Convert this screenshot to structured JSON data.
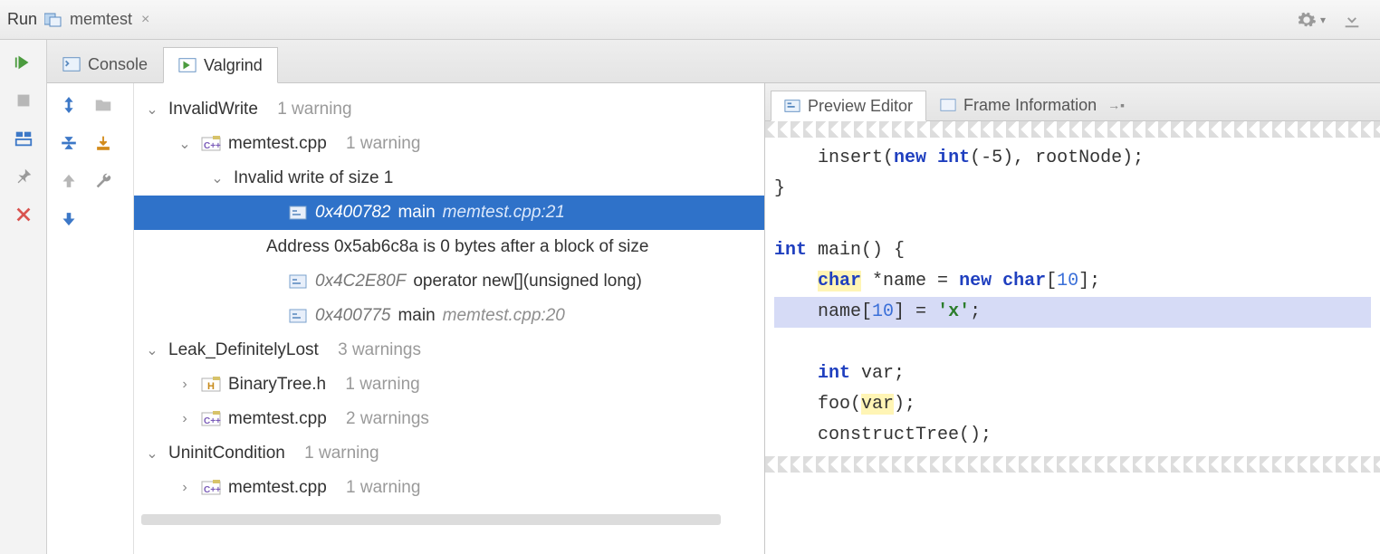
{
  "topbar": {
    "run": "Run",
    "config_name": "memtest"
  },
  "tabs": {
    "console": "Console",
    "valgrind": "Valgrind"
  },
  "tree": [
    {
      "level": 0,
      "twisty": "v",
      "kind": "group",
      "label": "InvalidWrite",
      "meta": "1 warning"
    },
    {
      "level": 1,
      "twisty": "v",
      "kind": "cpp",
      "label": "memtest.cpp",
      "meta": "1 warning"
    },
    {
      "level": 2,
      "twisty": "v",
      "kind": "none",
      "label": "Invalid write of size 1",
      "meta": ""
    },
    {
      "level": 3,
      "twisty": "",
      "kind": "frame",
      "addr": "0x400782",
      "func": "main",
      "loc": "memtest.cpp:21",
      "selected": true
    },
    {
      "level": 3,
      "twisty": "",
      "kind": "none",
      "label": "Address 0x5ab6c8a is 0 bytes after a block of size",
      "meta": "",
      "wrap": true
    },
    {
      "level": 3,
      "twisty": "",
      "kind": "frame",
      "addr": "0x4C2E80F",
      "func": "operator new[](unsigned long)",
      "loc": ""
    },
    {
      "level": 3,
      "twisty": "",
      "kind": "frame",
      "addr": "0x400775",
      "func": "main",
      "loc": "memtest.cpp:20"
    },
    {
      "level": 0,
      "twisty": "v",
      "kind": "group",
      "label": "Leak_DefinitelyLost",
      "meta": "3 warnings"
    },
    {
      "level": 1,
      "twisty": ">",
      "kind": "h",
      "label": "BinaryTree.h",
      "meta": "1 warning"
    },
    {
      "level": 1,
      "twisty": ">",
      "kind": "cpp",
      "label": "memtest.cpp",
      "meta": "2 warnings"
    },
    {
      "level": 0,
      "twisty": "v",
      "kind": "group",
      "label": "UninitCondition",
      "meta": "1 warning"
    },
    {
      "level": 1,
      "twisty": ">",
      "kind": "cpp",
      "label": "memtest.cpp",
      "meta": "1 warning"
    }
  ],
  "right_tabs": {
    "preview": "Preview Editor",
    "frame_info": "Frame Information"
  },
  "code": {
    "l1a": "    insert(",
    "l1b": "new",
    "l1c": " ",
    "l1d": "int",
    "l1e": "(-5), rootNode);",
    "l2": "}",
    "l3": "",
    "l4a": "int",
    "l4b": " main() {",
    "l5a": "    ",
    "l5b": "char",
    "l5c": " *name = ",
    "l5d": "new",
    "l5e": " ",
    "l5f": "char",
    "l5g": "[",
    "l5h": "10",
    "l5i": "];",
    "l6a": "    name[",
    "l6b": "10",
    "l6c": "] = ",
    "l6d": "'x'",
    "l6e": ";",
    "l7": "",
    "l8a": "    ",
    "l8b": "int",
    "l8c": " var;",
    "l9a": "    foo(",
    "l9b": "var",
    "l9c": ");",
    "l10": "    constructTree();"
  }
}
